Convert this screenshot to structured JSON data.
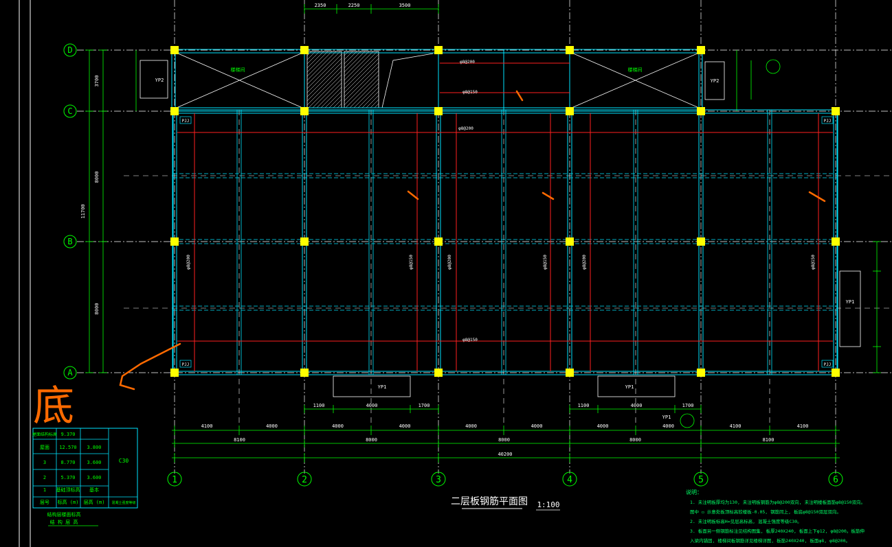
{
  "drawing": {
    "title": "二层板钢筋平面图",
    "scale": "1:100",
    "background": "#000000",
    "colors": {
      "grid": "#00ff00",
      "beam": "#00e5ff",
      "column": "#ffff00",
      "rebar": "#ff2020",
      "axis_line": "#ffffff",
      "markup": "#ff6a00",
      "notes": "#00ff66"
    },
    "axes_vertical": [
      "1",
      "2",
      "3",
      "4",
      "5",
      "6"
    ],
    "axes_horizontal": [
      "D",
      "C",
      "B",
      "A"
    ],
    "dims_span_row1": [
      "4100",
      "4000",
      "4000",
      "4000",
      "4000",
      "4000",
      "4000",
      "4000",
      "4100",
      "4100"
    ],
    "dims_span_row2": [
      "8100",
      "8000",
      "8000",
      "8000",
      "8100"
    ],
    "dims_total": "40200",
    "dims_top": [
      "2350",
      "2250",
      "3500"
    ],
    "dims_left": [
      "3700",
      "8000",
      "11700",
      "8000"
    ],
    "dims_balcony": [
      "1100",
      "4000",
      "1700"
    ],
    "rebar_labels": [
      "φ8@200",
      "φ8@150",
      "φ8@200",
      "φ8@150"
    ],
    "stair_labels": [
      "楼梯间",
      "楼梯间"
    ],
    "yp_labels": [
      "YP2",
      "YP2",
      "YP1",
      "YP1",
      "YP1",
      "YP1"
    ],
    "corner_tags": [
      "PJJ",
      "PJJ",
      "PJJ",
      "PJJ"
    ],
    "markup_text": "底",
    "level_table": {
      "header": [
        "屋面结构标高",
        "9.370"
      ],
      "rows": [
        [
          "屋面",
          "12.570",
          "3.800"
        ],
        [
          "3",
          "8.770",
          "3.600"
        ],
        [
          "2",
          "5.370",
          "3.600"
        ],
        [
          "1",
          "基础顶标高",
          "基本"
        ],
        [
          "层号",
          "标高 (m)",
          "层高 (m)"
        ]
      ],
      "side_value": "C30",
      "side_header": "混凝土强度等级",
      "caption_line1": "结构层楼面标高",
      "caption_line2": "结 构 层 高"
    },
    "notes": {
      "heading": "说明：",
      "lines": [
        "1. 未注明板厚均为130, 未注明板钢筋为φ8@200双向, 未注明楼板面筋φ8@150双向。",
        "   图中 ▭ 示意处板顶标高较楼板-0.05, 钢筋同上, 板底φ8@150双层双向。",
        "2. 未注明板标高H=见层高标高, 混凝土强度等级C30。",
        "3. 板面另一侧钢筋标注见结构图集, 板厚240X240, 板面上下φ12, φ8@200。板筋伸",
        "   入梁内锚固, 楼梯间板钢筋详见楼梯详图, 板筋240X240, 板面φ8, φ8@200。"
      ]
    }
  }
}
